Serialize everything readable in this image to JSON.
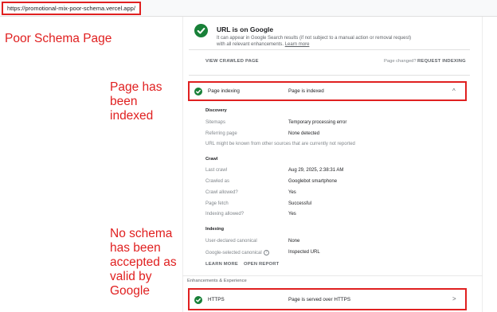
{
  "browser": {
    "url": "https://promotional-mix-poor-schema.vercel.app/"
  },
  "annotations": {
    "page_title": "Poor Schema Page",
    "indexed_note": "Page has\nbeen\nindexed",
    "schema_note": "No schema\nhas been\naccepted as\nvalid by\nGoogle"
  },
  "summary": {
    "title": "URL is on Google",
    "description": "It can appear in Google Search results (if not subject to a manual action or removal request) with all relevant enhancements.",
    "learn_more": "Learn more",
    "view_crawled": "VIEW CRAWLED PAGE",
    "page_changed": "Page changed?",
    "request_indexing": "REQUEST INDEXING"
  },
  "indexing_row": {
    "label": "Page indexing",
    "status": "Page is indexed",
    "chevron": "^"
  },
  "discovery": {
    "heading": "Discovery",
    "sitemaps_label": "Sitemaps",
    "sitemaps_value": "Temporary processing error",
    "referring_label": "Referring page",
    "referring_value": "None detected",
    "note": "URL might be known from other sources that are currently not reported"
  },
  "crawl": {
    "heading": "Crawl",
    "last_crawl_label": "Last crawl",
    "last_crawl_value": "Aug 29, 2025, 2:38:31 AM",
    "crawled_as_label": "Crawled as",
    "crawled_as_value": "Googlebot smartphone",
    "allowed_label": "Crawl allowed?",
    "allowed_value": "Yes",
    "fetch_label": "Page fetch",
    "fetch_value": "Successful",
    "indexing_allowed_label": "Indexing allowed?",
    "indexing_allowed_value": "Yes"
  },
  "indexing": {
    "heading": "Indexing",
    "user_canonical_label": "User-declared canonical",
    "user_canonical_value": "None",
    "google_canonical_label": "Google-selected canonical",
    "google_canonical_value": "Inspected URL",
    "help_glyph": "?"
  },
  "footer_links": {
    "learn_more": "LEARN MORE",
    "open_report": "OPEN REPORT"
  },
  "enhancements": {
    "heading": "Enhancements & Experience",
    "https_label": "HTTPS",
    "https_status": "Page is served over HTTPS",
    "chevron": ">"
  },
  "colors": {
    "annotation_red": "#e02020",
    "success_green": "#188038"
  },
  "icons": {
    "status": "check-circle-icon",
    "expand": "chevron-up-icon",
    "open": "chevron-right-icon",
    "help": "help-circle-icon"
  }
}
